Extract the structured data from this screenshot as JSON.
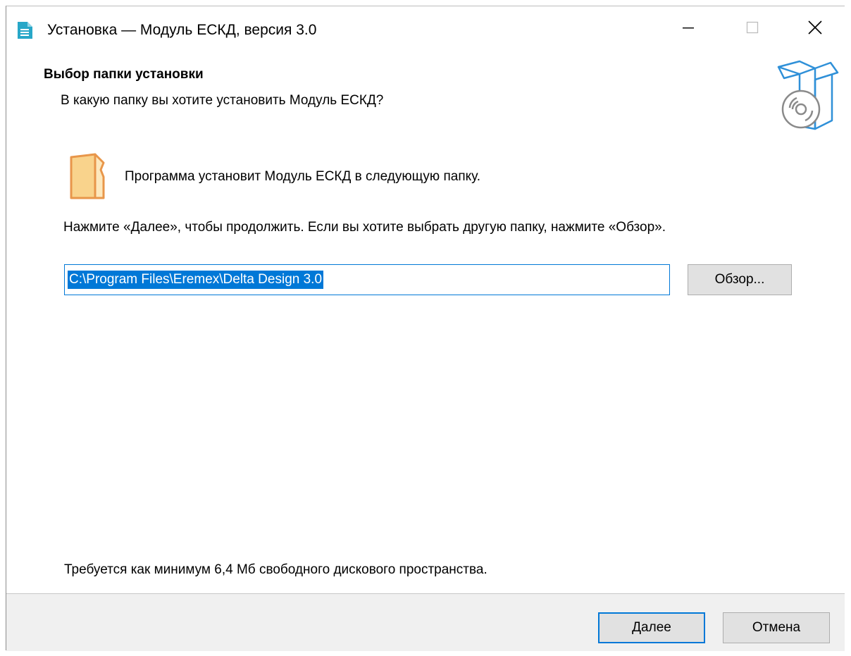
{
  "window": {
    "title": "Установка — Модуль ЕСКД, версия 3.0"
  },
  "header": {
    "title": "Выбор папки установки",
    "subtitle": "В какую папку вы хотите установить Модуль ЕСКД?"
  },
  "content": {
    "info": "Программа установит Модуль ЕСКД в следующую папку.",
    "instruction": "Нажмите «Далее», чтобы продолжить. Если вы хотите выбрать другую папку, нажмите «Обзор».",
    "path_value": "C:\\Program Files\\Eremex\\Delta Design 3.0",
    "browse_label": "Обзор...",
    "disk_space": "Требуется как минимум 6,4 Мб свободного дискового пространства."
  },
  "footer": {
    "next_label": "Далее",
    "cancel_label": "Отмена"
  },
  "icons": {
    "app": "setup-document-icon",
    "box": "software-box-disc-icon",
    "folder": "folder-icon",
    "minimize": "minimize-icon",
    "maximize": "maximize-icon",
    "close": "close-icon"
  },
  "colors": {
    "accent": "#0078d7",
    "folder": "#f9d38c",
    "folder_stroke": "#e8964a",
    "box_stroke": "#2f90d8",
    "footer_bg": "#f0f0f0"
  }
}
